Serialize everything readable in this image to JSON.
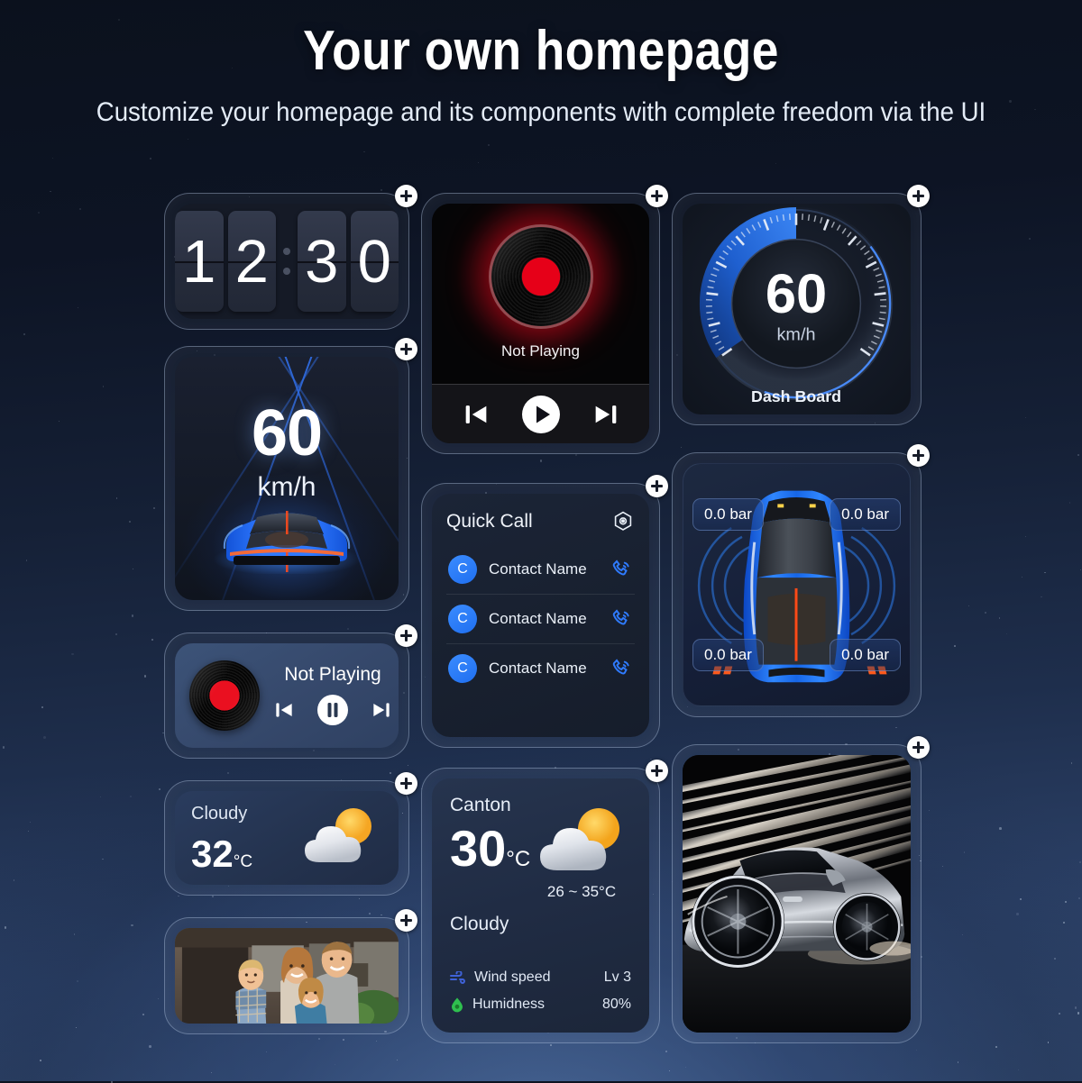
{
  "header": {
    "title": "Your own homepage",
    "subtitle": "Customize your homepage and its components with complete freedom via the UI"
  },
  "add_button_label": "+",
  "colors": {
    "accent_blue": "#2f7bff",
    "vinyl_red": "#e60018",
    "sun_yellow": "#f9c23c",
    "background_top": "#0b111d",
    "background_bottom": "#32496f"
  },
  "widgets": {
    "clock": {
      "name": "Flip Clock",
      "digits": [
        "1",
        "2",
        "3",
        "0"
      ],
      "separator": ":"
    },
    "music_large": {
      "name": "Music Player",
      "status": "Not Playing",
      "controls": [
        "previous-track",
        "play",
        "next-track"
      ]
    },
    "dashboard": {
      "name": "Dash Board",
      "speed": "60",
      "unit": "km/h",
      "label": "Dash Board",
      "gauge_percent": 42
    },
    "hud": {
      "name": "Head Up Display",
      "speed": "60",
      "unit": "km/h"
    },
    "quick_call": {
      "name": "Quick Call",
      "title": "Quick Call",
      "settings_icon": "hexagon-settings-icon",
      "contacts": [
        {
          "initial": "C",
          "name": "Contact Name",
          "action": "call"
        },
        {
          "initial": "C",
          "name": "Contact Name",
          "action": "call"
        },
        {
          "initial": "C",
          "name": "Contact Name",
          "action": "call"
        }
      ]
    },
    "tire_pressure": {
      "name": "Tire Pressure Monitor",
      "tires": [
        {
          "position": "front-left",
          "value": "0.0 bar"
        },
        {
          "position": "front-right",
          "value": "0.0 bar"
        },
        {
          "position": "rear-left",
          "value": "0.0 bar"
        },
        {
          "position": "rear-right",
          "value": "0.0 bar"
        }
      ]
    },
    "music_small": {
      "name": "Music Mini Player",
      "status": "Not Playing",
      "controls": [
        "previous-track",
        "pause",
        "next-track"
      ]
    },
    "weather_small": {
      "name": "Weather Mini",
      "condition": "Cloudy",
      "temperature": "32",
      "unit": "°C"
    },
    "weather_large": {
      "name": "Weather",
      "city": "Canton",
      "temperature": "30",
      "unit": "°C",
      "range": "26 ~ 35°C",
      "condition": "Cloudy",
      "details": [
        {
          "icon": "wind-icon",
          "label": "Wind speed",
          "value": "Lv 3"
        },
        {
          "icon": "humidity-icon",
          "label": "Humidness",
          "value": "80%"
        }
      ]
    },
    "photo": {
      "name": "Photo Frame",
      "alt": "family portrait"
    },
    "car_image": {
      "name": "Car Image",
      "alt": "silver sports car with light trails"
    }
  }
}
